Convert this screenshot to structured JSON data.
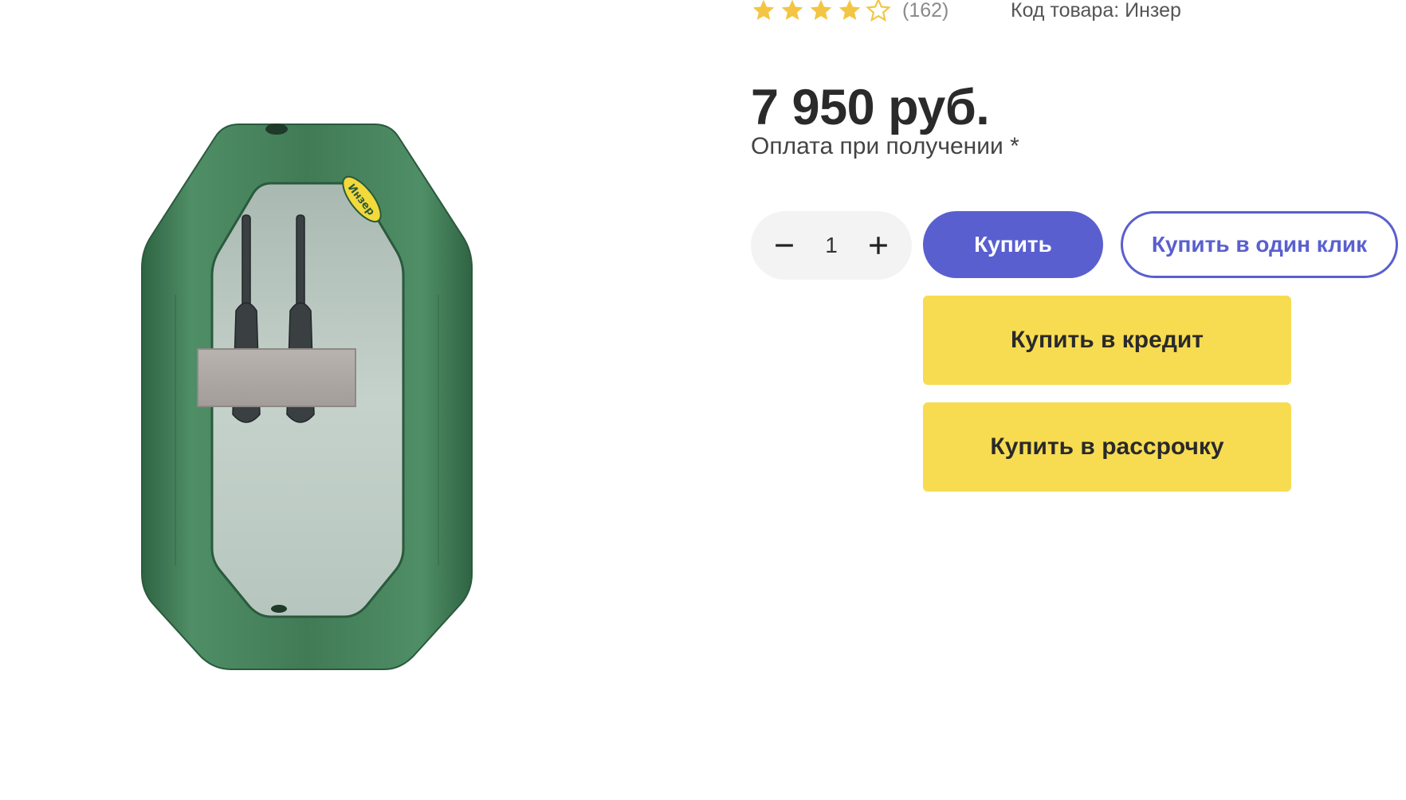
{
  "product": {
    "rating": {
      "value": 4,
      "max": 5,
      "count_label": "(162)",
      "star_color": "#f4c542",
      "empty_star_color": "#f4c542"
    },
    "sku_label": "Код товара: Инзер",
    "price": "7 950 руб.",
    "payment_note": "Оплата при получении *",
    "image_icon": "inflatable-boat-image",
    "brand_badge": "Инзер"
  },
  "quantity": {
    "value": "1",
    "minus_icon": "minus-icon",
    "plus_icon": "plus-icon"
  },
  "actions": {
    "buy_label": "Купить",
    "one_click_label": "Купить в один клик",
    "credit_label": "Купить в кредит",
    "installment_label": "Купить в рассрочку"
  },
  "colors": {
    "accent": "#5a5fcf",
    "yellow": "#f7dc52",
    "boat_green": "#3f7a56"
  }
}
